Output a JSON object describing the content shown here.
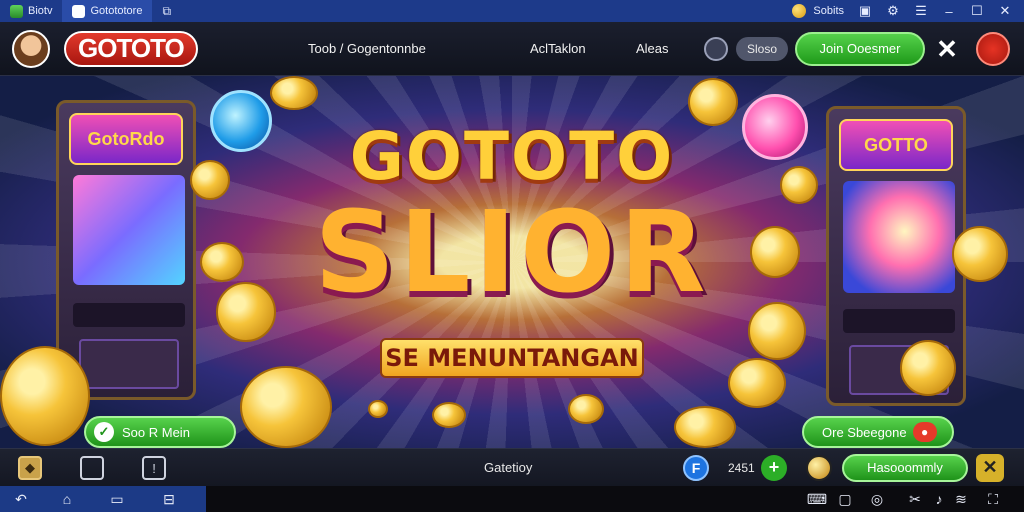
{
  "window": {
    "tabs": [
      {
        "label": "Biotv"
      },
      {
        "label": "Gotototore"
      }
    ],
    "coins_label": "Sobits"
  },
  "header": {
    "logo_text": "GOTOTO",
    "nav": [
      "Toob / Gogentonnbe",
      "AclTaklon",
      "Aleas"
    ],
    "pill_text": "Sloso",
    "join_button": "Join Ooesmer"
  },
  "banner": {
    "title_line1": "GOTOTO",
    "title_line2": "SLIOR",
    "subtitle": "SE MENUNTANGAN",
    "left_machine_logo": "GotoRdo",
    "right_machine_logo": "GOTTO",
    "left_button": "Soo R Mein",
    "right_button": "Ore Sbeegone"
  },
  "bottombar": {
    "title": "Gatetioy",
    "count": "2451",
    "recommend_button": "Hasooommly"
  },
  "colors": {
    "titlebar": "#1d3a8a",
    "accent_green": "#2cae27",
    "accent_red": "#e23a2c",
    "gold": "#ffd03a"
  }
}
